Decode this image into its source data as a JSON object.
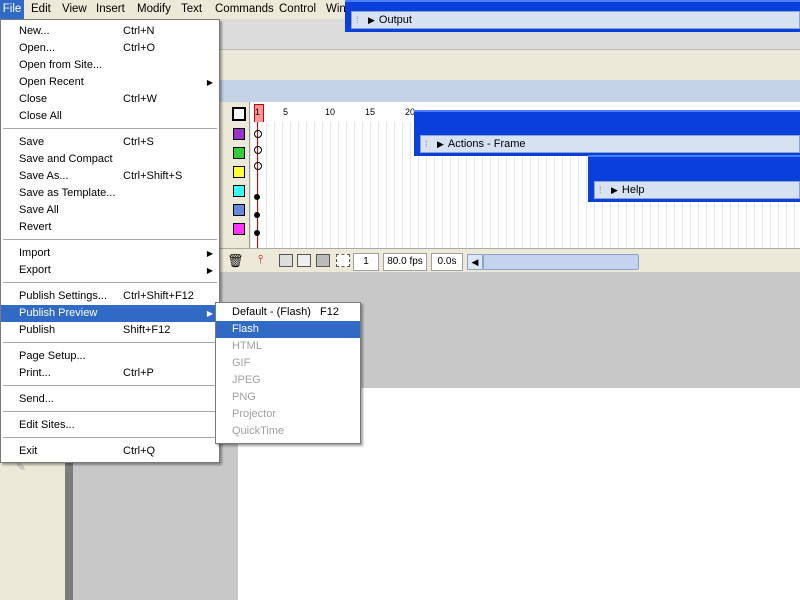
{
  "menubar": {
    "items": [
      "File",
      "Edit",
      "View",
      "Insert",
      "Modify",
      "Text",
      "Commands",
      "Control",
      "Win"
    ]
  },
  "panels": {
    "output": "Output",
    "actions": "Actions - Frame",
    "help": "Help"
  },
  "timeline": {
    "ruler": [
      "1",
      "5",
      "10",
      "15",
      "20"
    ],
    "current_frame": "1",
    "fps": "80.0 fps",
    "time": "0.0s"
  },
  "file_menu": {
    "items": [
      {
        "label": "New...",
        "shortcut": "Ctrl+N"
      },
      {
        "label": "Open...",
        "shortcut": "Ctrl+O"
      },
      {
        "label": "Open from Site...",
        "shortcut": ""
      },
      {
        "label": "Open Recent",
        "shortcut": "",
        "submenu": true
      },
      {
        "label": "Close",
        "shortcut": "Ctrl+W"
      },
      {
        "label": "Close All",
        "shortcut": ""
      },
      {
        "label": "Save",
        "shortcut": "Ctrl+S"
      },
      {
        "label": "Save and Compact",
        "shortcut": ""
      },
      {
        "label": "Save As...",
        "shortcut": "Ctrl+Shift+S"
      },
      {
        "label": "Save as Template...",
        "shortcut": ""
      },
      {
        "label": "Save All",
        "shortcut": ""
      },
      {
        "label": "Revert",
        "shortcut": ""
      },
      {
        "label": "Import",
        "shortcut": "",
        "submenu": true
      },
      {
        "label": "Export",
        "shortcut": "",
        "submenu": true
      },
      {
        "label": "Publish Settings...",
        "shortcut": "Ctrl+Shift+F12"
      },
      {
        "label": "Publish Preview",
        "shortcut": "",
        "submenu": true,
        "highlighted": true
      },
      {
        "label": "Publish",
        "shortcut": "Shift+F12"
      },
      {
        "label": "Page Setup...",
        "shortcut": ""
      },
      {
        "label": "Print...",
        "shortcut": "Ctrl+P"
      },
      {
        "label": "Send...",
        "shortcut": ""
      },
      {
        "label": "Edit Sites...",
        "shortcut": ""
      },
      {
        "label": "Exit",
        "shortcut": "Ctrl+Q"
      }
    ]
  },
  "publish_preview_menu": {
    "items": [
      {
        "label": "Default - (Flash)",
        "shortcut": "F12",
        "enabled": true
      },
      {
        "label": "Flash",
        "shortcut": "",
        "enabled": true,
        "highlighted": true
      },
      {
        "label": "HTML",
        "shortcut": "",
        "enabled": false
      },
      {
        "label": "GIF",
        "shortcut": "",
        "enabled": false
      },
      {
        "label": "JPEG",
        "shortcut": "",
        "enabled": false
      },
      {
        "label": "PNG",
        "shortcut": "",
        "enabled": false
      },
      {
        "label": "Projector",
        "shortcut": "",
        "enabled": false
      },
      {
        "label": "QuickTime",
        "shortcut": "",
        "enabled": false
      }
    ]
  },
  "layer_colors": [
    "#9933cc",
    "#33cc33",
    "#ffff33",
    "#33ffff",
    "#6688dd",
    "#ff33ff"
  ]
}
